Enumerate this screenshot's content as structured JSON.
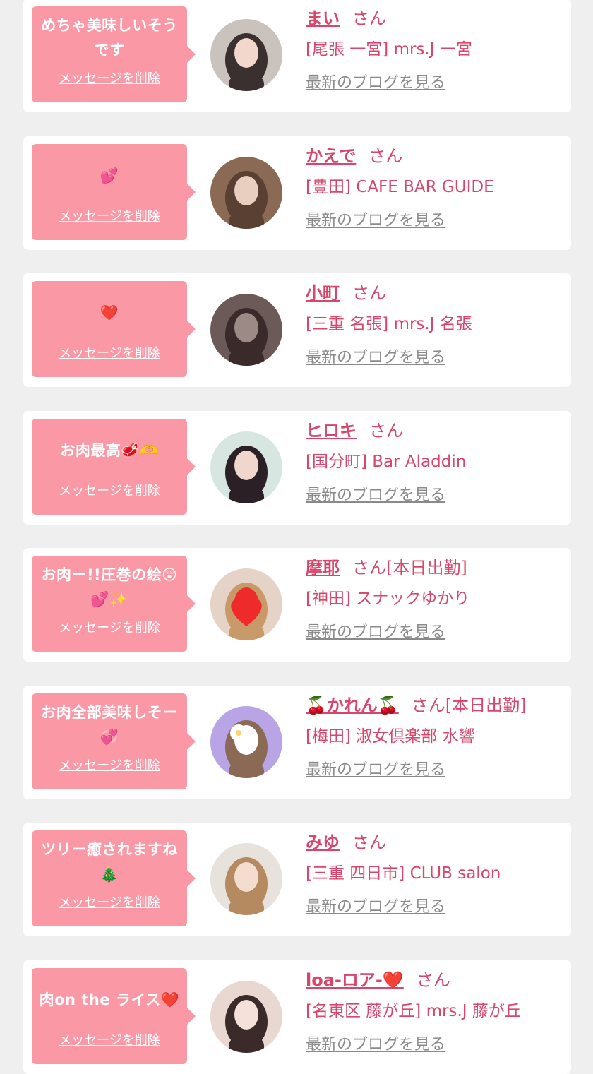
{
  "delete_label": "メッセージを削除",
  "blog_label": "最新のブログを見る",
  "honorific": "さん",
  "colors": {
    "background": "#efefef",
    "card": "#ffffff",
    "bubble": "#fb98a6",
    "accent": "#d9456b",
    "link_gray": "#8a8a8a"
  },
  "items": [
    {
      "message": "めちゃ美味しいそうです",
      "name": "まい",
      "status": "",
      "shop": "[尾張 一宮] mrs.J 一宮",
      "avatar": "avatar-1"
    },
    {
      "message": "💕",
      "name": "かえで",
      "status": "",
      "shop": "[豊田] CAFE BAR GUIDE",
      "avatar": "avatar-2"
    },
    {
      "message": "❤️",
      "name": "小町",
      "status": "",
      "shop": "[三重 名張] mrs.J 名張",
      "avatar": "avatar-3"
    },
    {
      "message": "お肉最高🥩🫶",
      "name": "ヒロキ",
      "status": "",
      "shop": "[国分町] Bar Aladdin",
      "avatar": "avatar-4"
    },
    {
      "message": "お肉ー!!圧巻の絵😲💕✨",
      "name": "摩耶",
      "status": "[本日出勤]",
      "shop": "[神田] スナックゆかり",
      "avatar": "avatar-5"
    },
    {
      "message": "お肉全部美味しそー💞",
      "name": "🍒かれん🍒",
      "status": "[本日出勤]",
      "shop": "[梅田] 淑女倶楽部 水響",
      "avatar": "avatar-6"
    },
    {
      "message": "ツリー癒されますね🎄",
      "name": "みゆ",
      "status": "",
      "shop": "[三重 四日市] CLUB salon",
      "avatar": "avatar-7"
    },
    {
      "message": "肉on the ライス❤️",
      "name": "loa-ロア-❤️",
      "status": "",
      "shop": "[名東区 藤が丘] mrs.J 藤が丘",
      "avatar": "avatar-8"
    }
  ]
}
